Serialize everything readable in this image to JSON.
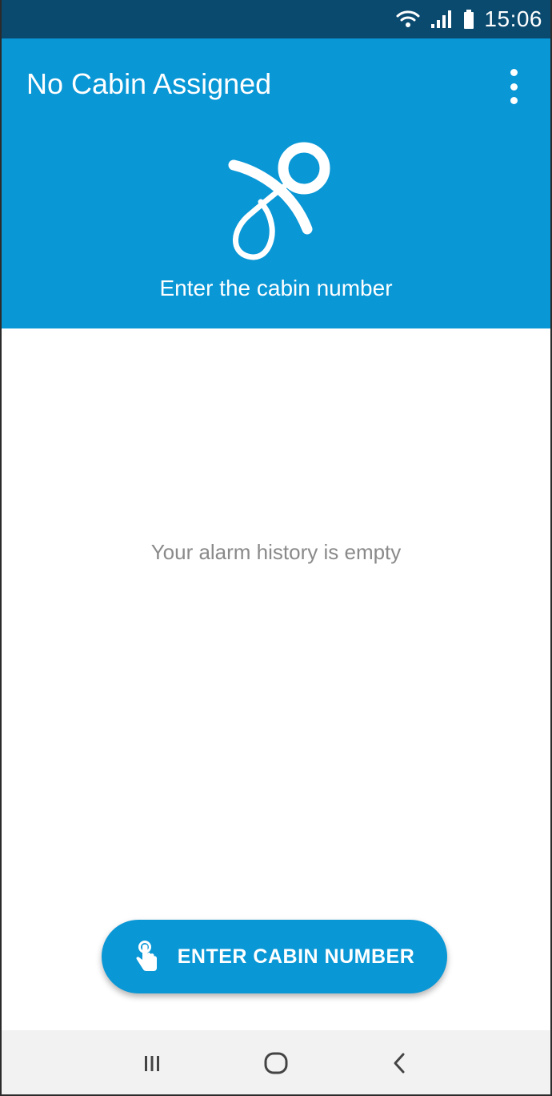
{
  "status_bar": {
    "time": "15:06",
    "icons": [
      "wifi-icon",
      "signal-icon",
      "battery-icon"
    ]
  },
  "header": {
    "title": "No Cabin Assigned",
    "subtitle": "Enter the cabin number",
    "menu_icon": "more-vert-icon",
    "logo_icon": "pacifier-icon"
  },
  "content": {
    "empty_message": "Your alarm history is empty"
  },
  "fab": {
    "label": "ENTER CABIN NUMBER",
    "icon": "touch-hand-icon"
  },
  "nav_bar": {
    "buttons": [
      "recents-icon",
      "home-icon",
      "back-icon"
    ]
  },
  "colors": {
    "status_bar": "#0b4a6f",
    "primary": "#0997d6",
    "nav_bar": "#f2f2f2",
    "empty_text": "#8a8a8a"
  }
}
